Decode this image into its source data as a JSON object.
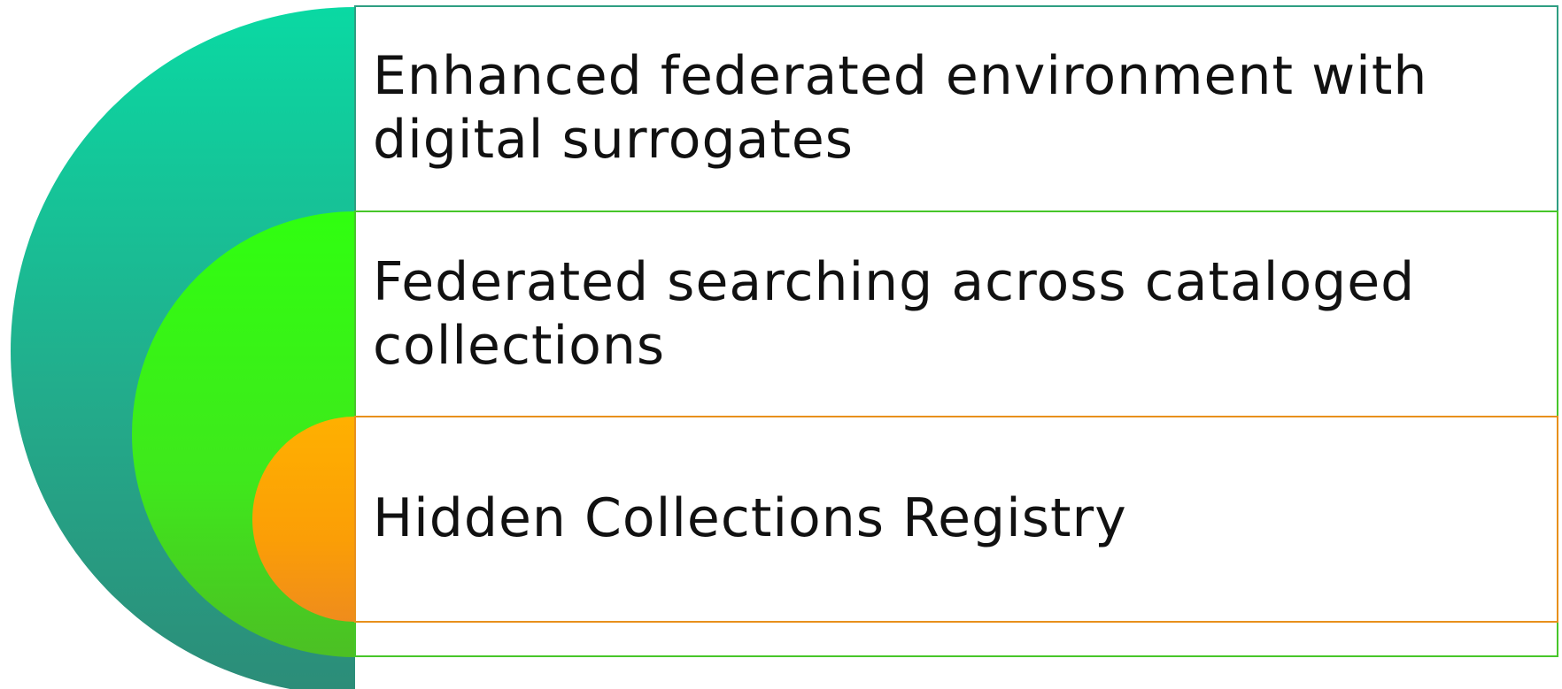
{
  "levels": [
    {
      "label": "Enhanced federated environment with digital surrogates",
      "color": "#2e9e82",
      "accent": "#08d8a0"
    },
    {
      "label": "Federated searching across cataloged collections",
      "color": "#47c62a",
      "accent": "#30ff10"
    },
    {
      "label": "Hidden Collections Registry",
      "color": "#e8901c",
      "accent": "#ffad00"
    }
  ]
}
